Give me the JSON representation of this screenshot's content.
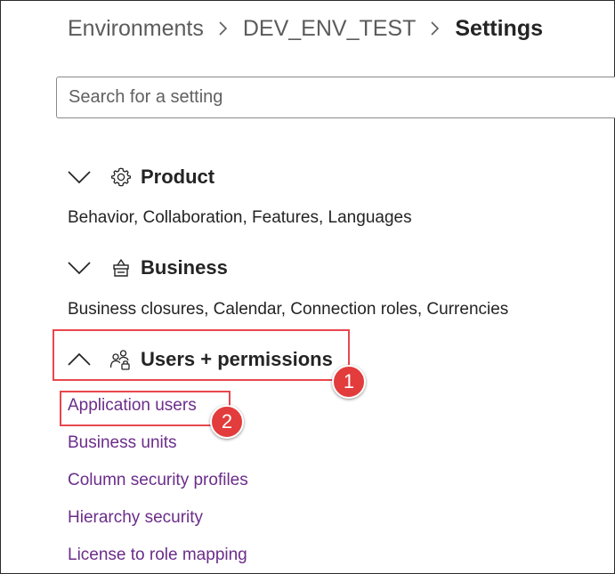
{
  "breadcrumb": {
    "items": [
      "Environments",
      "DEV_ENV_TEST"
    ],
    "current": "Settings"
  },
  "search": {
    "placeholder": "Search for a setting",
    "value": ""
  },
  "sections": [
    {
      "title": "Product",
      "icon": "gear-icon",
      "expanded": false,
      "description": "Behavior, Collaboration, Features, Languages"
    },
    {
      "title": "Business",
      "icon": "building-icon",
      "expanded": false,
      "description": "Business closures, Calendar, Connection roles, Currencies"
    },
    {
      "title": "Users + permissions",
      "icon": "people-lock-icon",
      "expanded": true,
      "links": [
        "Application users",
        "Business units",
        "Column security profiles",
        "Hierarchy security",
        "License to role mapping"
      ]
    }
  ],
  "annotations": {
    "step1": "1",
    "step2": "2",
    "color": "#e23c3c"
  }
}
